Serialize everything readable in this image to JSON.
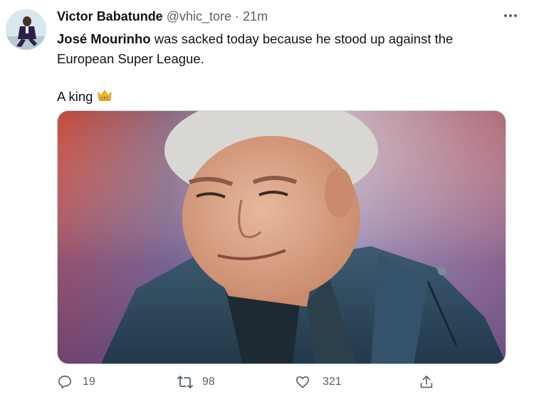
{
  "tweet": {
    "author_name": "Victor Babatunde",
    "handle": "@vhic_tore",
    "separator": "·",
    "time": "21m",
    "text_bold": "José Mourinho",
    "text_rest_line1": " was sacked today because he stood up against the",
    "text_line2": "European Super League.",
    "text_line3": "A king",
    "emoji": "crown-emoji"
  },
  "actions": {
    "reply_count": "19",
    "retweet_count": "98",
    "like_count": "321"
  },
  "icons": {
    "more": "more-horizontal-icon",
    "reply": "reply-icon",
    "retweet": "retweet-icon",
    "like": "heart-icon",
    "share": "share-icon"
  },
  "colors": {
    "text": "#0f1419",
    "secondary": "#536471",
    "border": "#cfd9de"
  }
}
